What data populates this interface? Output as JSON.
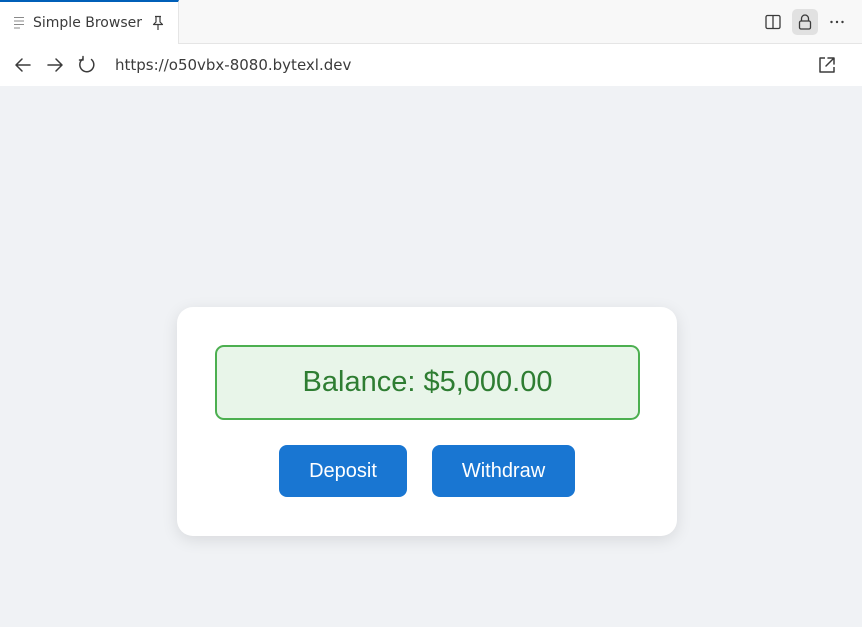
{
  "tab": {
    "title": "Simple Browser"
  },
  "toolbar": {
    "url": "https://o50vbx-8080.bytexl.dev"
  },
  "account": {
    "balance_text": "Balance: $5,000.00",
    "deposit_label": "Deposit",
    "withdraw_label": "Withdraw"
  },
  "colors": {
    "accent": "#1976d2",
    "balance_text": "#2e7d32",
    "balance_bg": "#e8f5e9",
    "balance_border": "#4caf50"
  },
  "icons": [
    "document-icon",
    "pin-icon",
    "split-editor-icon",
    "lock-icon",
    "more-icon",
    "back-arrow-icon",
    "forward-arrow-icon",
    "reload-icon",
    "open-external-icon"
  ]
}
